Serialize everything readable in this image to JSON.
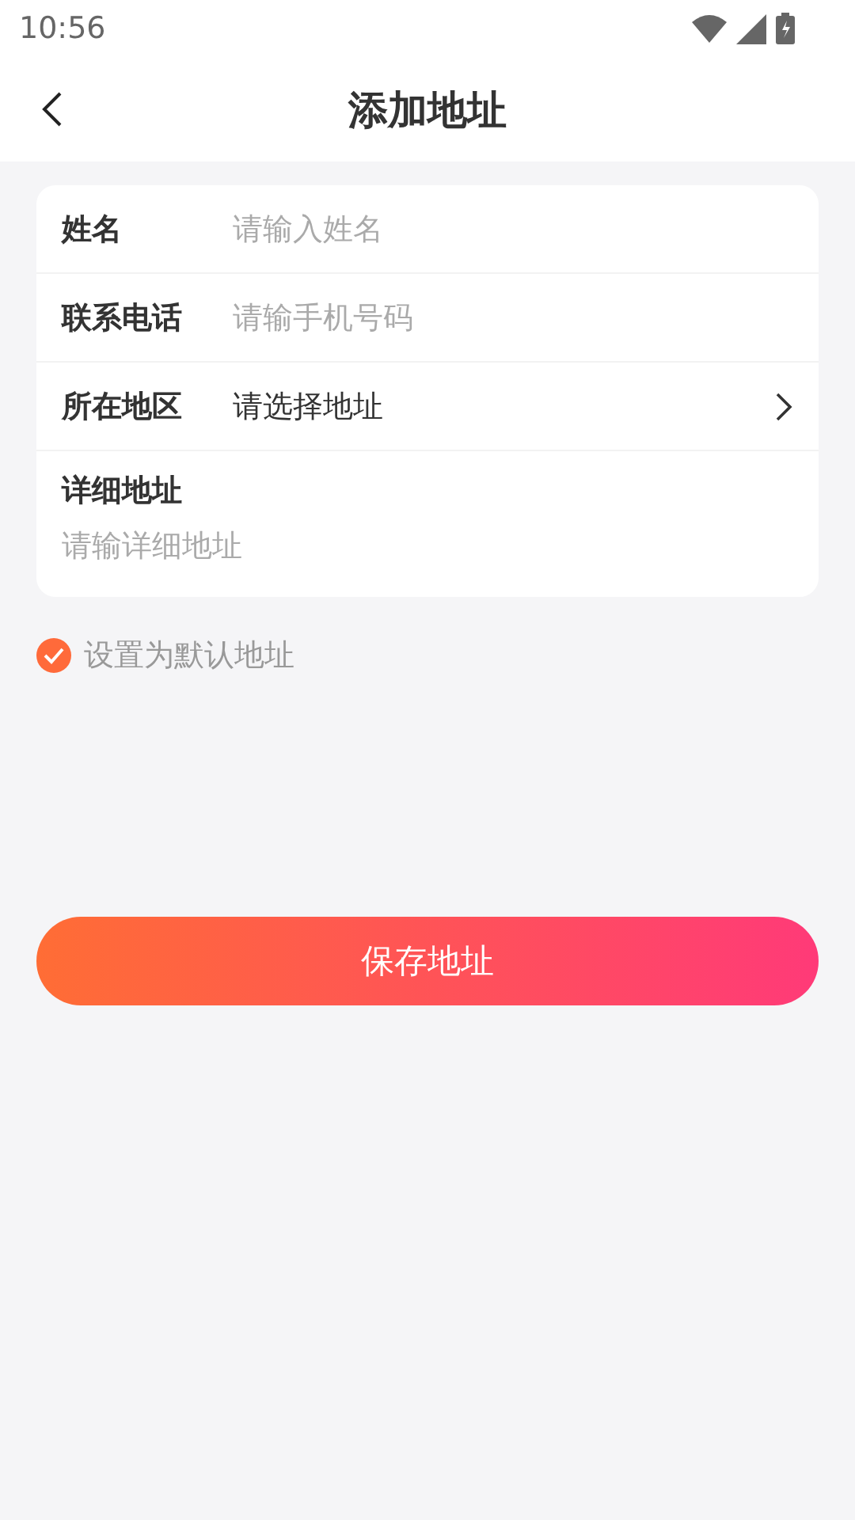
{
  "status_bar": {
    "time": "10:56"
  },
  "header": {
    "title": "添加地址"
  },
  "form": {
    "rows": [
      {
        "kind": "input",
        "label": "姓名",
        "placeholder": "请输入姓名"
      },
      {
        "kind": "input",
        "label": "联系电话",
        "placeholder": "请输手机号码"
      },
      {
        "kind": "picker",
        "label": "所在地区",
        "value": "请选择地址"
      },
      {
        "kind": "textarea",
        "label": "详细地址",
        "placeholder": "请输详细地址"
      }
    ]
  },
  "default_option": {
    "label": "设置为默认地址",
    "checked": true
  },
  "save_button": {
    "label": "保存地址"
  }
}
